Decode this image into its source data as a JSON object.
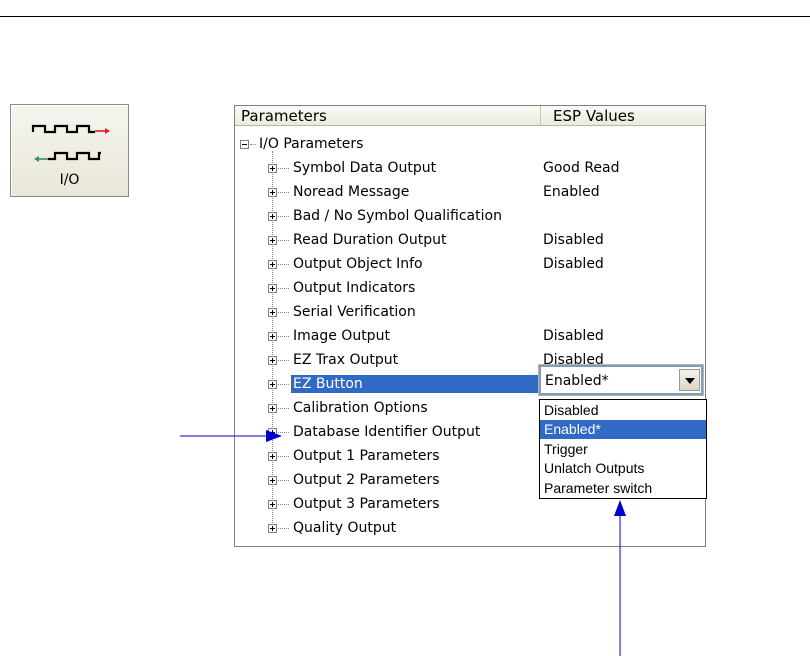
{
  "io_button": {
    "label": "I/O",
    "icon": "io-signal-icon"
  },
  "table": {
    "headers": {
      "parameters": "Parameters",
      "esp_values": "ESP Values"
    },
    "root": {
      "label": "I/O Parameters",
      "expander": "minus"
    },
    "rows": [
      {
        "label": "Symbol Data Output",
        "value": "Good Read"
      },
      {
        "label": "Noread Message",
        "value": "Enabled"
      },
      {
        "label": "Bad / No Symbol Qualification",
        "value": ""
      },
      {
        "label": "Read Duration Output",
        "value": "Disabled"
      },
      {
        "label": "Output Object Info",
        "value": "Disabled"
      },
      {
        "label": "Output Indicators",
        "value": ""
      },
      {
        "label": "Serial Verification",
        "value": ""
      },
      {
        "label": "Image Output",
        "value": "Disabled"
      },
      {
        "label": "EZ Trax Output",
        "value": "Disabled"
      },
      {
        "label": "EZ Button",
        "value": "",
        "selected": true
      },
      {
        "label": "Calibration Options",
        "value": ""
      },
      {
        "label": "Database Identifier Output",
        "value": ""
      },
      {
        "label": "Output 1 Parameters",
        "value": ""
      },
      {
        "label": "Output 2 Parameters",
        "value": ""
      },
      {
        "label": "Output 3 Parameters",
        "value": ""
      },
      {
        "label": "Quality Output",
        "value": ""
      }
    ]
  },
  "combo": {
    "value": "Enabled*"
  },
  "dropdown": {
    "options": [
      "Disabled",
      "Enabled*",
      "Trigger",
      "Unlatch Outputs",
      "Parameter switch"
    ],
    "selected_index": 1
  },
  "colors": {
    "selection": "#316ac5",
    "arrow": "#0000cc",
    "io_arrow_red": "#e0201b",
    "io_arrow_green": "#3d8a6a"
  }
}
